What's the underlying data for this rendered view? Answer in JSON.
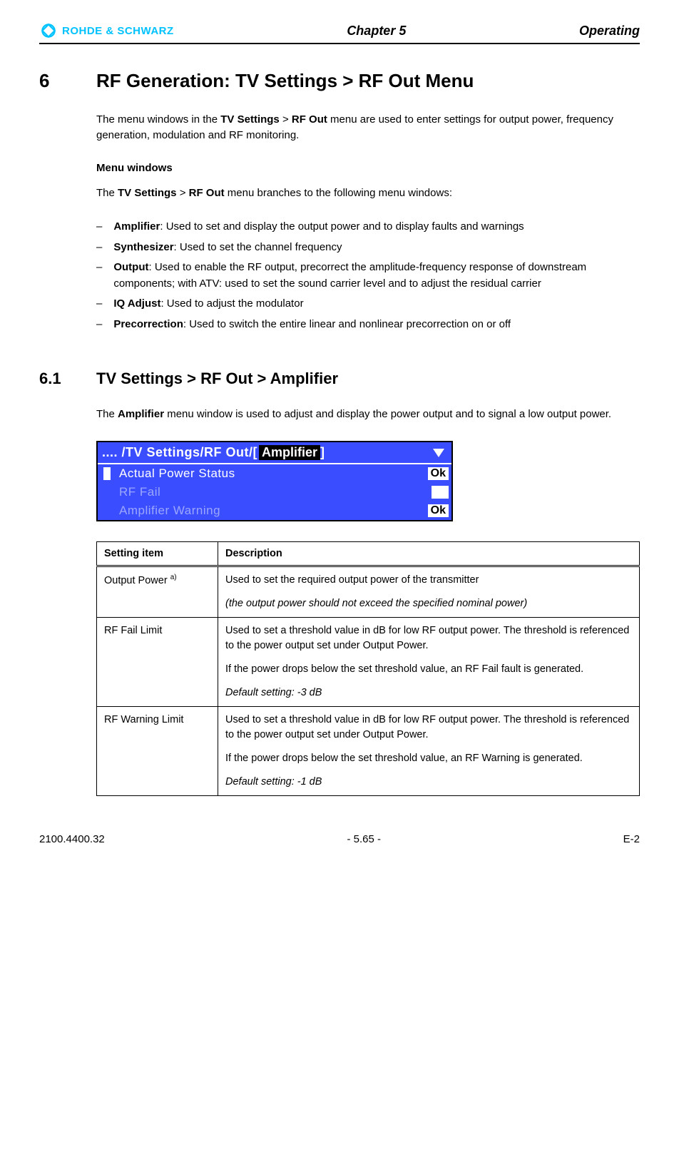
{
  "header": {
    "logo_text": "ROHDE & SCHWARZ",
    "center": "Chapter 5",
    "right": "Operating"
  },
  "section": {
    "num": "6",
    "title": "RF Generation: TV Settings > RF Out Menu",
    "intro": {
      "p1_a": "The menu windows in the ",
      "p1_b": "TV Settings",
      "p1_c": " > ",
      "p1_d": "RF Out",
      "p1_e": " menu are used to enter settings for output power, frequency generation, modulation and RF monitoring."
    },
    "menu_windows_heading": "Menu windows",
    "mw_intro_a": "The ",
    "mw_intro_b": "TV Settings",
    "mw_intro_c": " > ",
    "mw_intro_d": "RF Out",
    "mw_intro_e": " menu branches to the following menu windows:",
    "items": [
      {
        "name": "Amplifier",
        "desc": ": Used to set and display the output power and to display faults and warnings"
      },
      {
        "name": "Synthesizer",
        "desc": ": Used to set the channel frequency"
      },
      {
        "name": "Output",
        "desc": ": Used to enable the RF output, precorrect the amplitude-frequency response of downstream components; with ATV: used to set the sound carrier level and to adjust the residual carrier"
      },
      {
        "name": "IQ Adjust",
        "desc": ": Used to adjust the modulator"
      },
      {
        "name": "Precorrection",
        "desc": ": Used to switch the entire linear and nonlinear precorrection on or off"
      }
    ]
  },
  "subsection": {
    "num": "6.1",
    "title": "TV Settings > RF Out > Amplifier",
    "intro_a": "The ",
    "intro_b": "Amplifier",
    "intro_c": " menu window is used to adjust and display the power output and to signal a low output power."
  },
  "screenshot": {
    "path": ".... /TV Settings/RF Out/",
    "tab_open": "[ ",
    "tab_label": "Amplifier",
    "tab_close": " ]",
    "rows": [
      {
        "label": "Actual Power Status",
        "value": "Ok",
        "muted": false,
        "selected": true
      },
      {
        "label": "RF Fail",
        "value": "",
        "muted": true,
        "selected": false
      },
      {
        "label": "Amplifier Warning",
        "value": "Ok",
        "muted": true,
        "selected": false
      }
    ]
  },
  "table": {
    "head": {
      "c1": "Setting item",
      "c2": "Description"
    },
    "rows": [
      {
        "item": "Output Power",
        "sup": "a)",
        "desc": {
          "p1": "Used to set the required output power of the transmitter",
          "p2_italic": "(the output power should not exceed the specified nominal power)"
        }
      },
      {
        "item": "RF Fail Limit",
        "sup": "",
        "desc": {
          "p1": "Used to set a threshold value in dB for low RF output power. The threshold is referenced to the power output set under Output Power.",
          "p2": "If the power drops below the set threshold value, an RF Fail fault is generated.",
          "p3_italic": "Default setting: -3 dB"
        }
      },
      {
        "item": "RF Warning Limit",
        "sup": "",
        "desc": {
          "p1": "Used to set a threshold value in dB for low RF output power. The threshold is referenced to the power output set under Output Power.",
          "p2": "If the power drops below the set threshold value, an RF Warning is generated.",
          "p3_italic": "Default setting: -1 dB"
        }
      }
    ]
  },
  "footer": {
    "left": "2100.4400.32",
    "center": "- 5.65 -",
    "right": "E-2"
  }
}
